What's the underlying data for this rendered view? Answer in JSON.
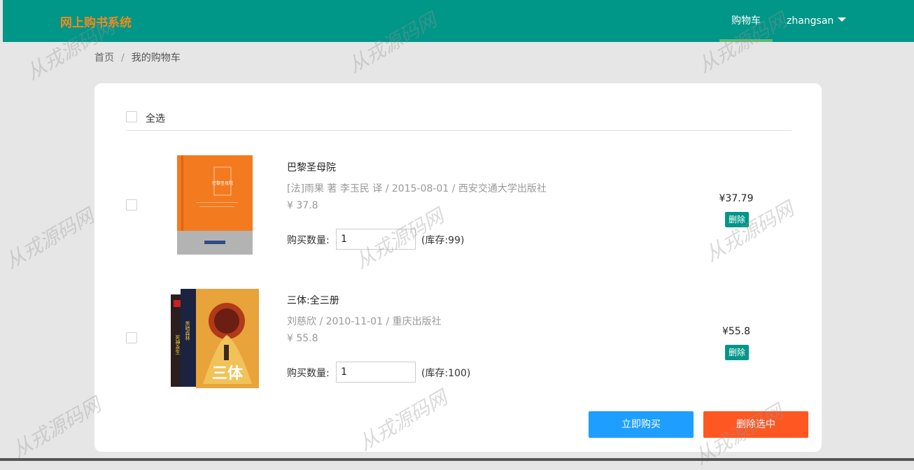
{
  "header": {
    "logo": "网上购书系统",
    "nav_cart": "购物车",
    "username": "zhangsan"
  },
  "breadcrumb": {
    "home": "首页",
    "separator": "/",
    "current": "我的购物车"
  },
  "cart": {
    "select_all_label": "全选",
    "items": [
      {
        "title": "巴黎圣母院",
        "meta": "[法]雨果 著 李玉民 译 / 2015-08-01 / 西安交通大学出版社",
        "price": "¥ 37.8",
        "qty_label": "购买数量:",
        "qty_value": "1",
        "stock": "(库存:99)",
        "subtotal": "¥37.79",
        "delete_label": "删除",
        "cover_color": "#f47a1f"
      },
      {
        "title": "三体:全三册",
        "meta": "刘慈欣 / 2010-11-01 / 重庆出版社",
        "price": "¥ 55.8",
        "qty_label": "购买数量:",
        "qty_value": "1",
        "stock": "(库存:100)",
        "subtotal": "¥55.8",
        "delete_label": "删除",
        "cover_color": "#e8a33a"
      }
    ],
    "buy_now_label": "立即购买",
    "delete_selected_label": "删除选中"
  },
  "watermark_text": "从戎源码网",
  "colors": {
    "header_bg": "#009688",
    "logo": "#f08a1a",
    "buy_button": "#1e9fff",
    "delete_selected_button": "#ff5722",
    "delete_button": "#009688"
  }
}
